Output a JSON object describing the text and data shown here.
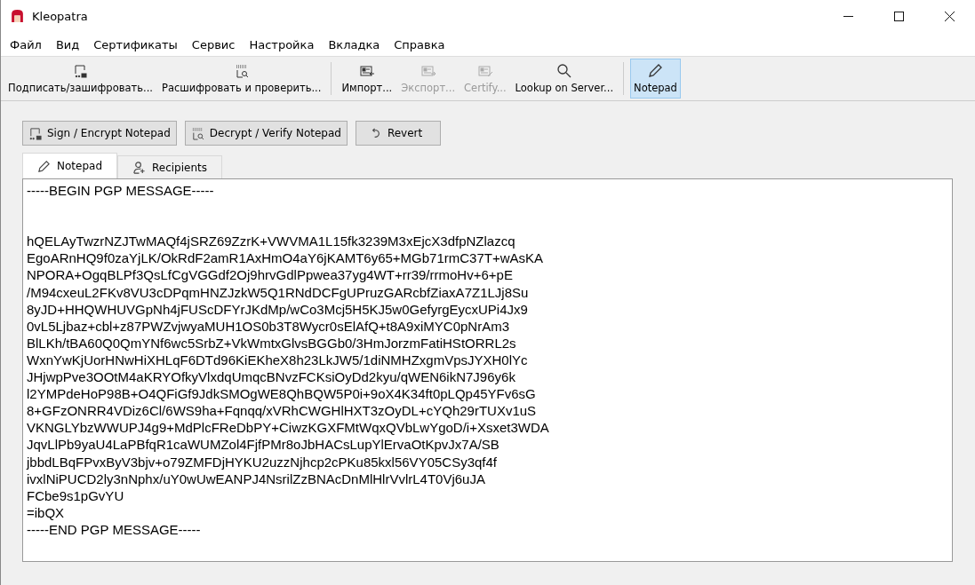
{
  "window": {
    "title": "Kleopatra"
  },
  "menu": [
    "Файл",
    "Вид",
    "Сертификаты",
    "Сервис",
    "Настройка",
    "Вкладка",
    "Справка"
  ],
  "toolbar": [
    {
      "kind": "sign",
      "label": "Подписать/зашифровать...",
      "enabled": true,
      "selected": false
    },
    {
      "kind": "decrypt",
      "label": "Расшифровать и проверить...",
      "enabled": true,
      "selected": false
    },
    {
      "kind": "import",
      "label": "Импорт...",
      "enabled": true,
      "selected": false
    },
    {
      "kind": "export",
      "label": "Экспорт...",
      "enabled": false,
      "selected": false
    },
    {
      "kind": "certify",
      "label": "Certify...",
      "enabled": false,
      "selected": false
    },
    {
      "kind": "lookup",
      "label": "Lookup on Server...",
      "enabled": true,
      "selected": false
    },
    {
      "kind": "notepad",
      "label": "Notepad",
      "enabled": true,
      "selected": true
    }
  ],
  "actions": [
    {
      "kind": "sign",
      "label": "Sign / Encrypt Notepad"
    },
    {
      "kind": "decrypt",
      "label": "Decrypt / Verify Notepad"
    },
    {
      "kind": "revert",
      "label": "Revert"
    }
  ],
  "tabs": [
    {
      "kind": "notepad",
      "label": "Notepad",
      "selected": true
    },
    {
      "kind": "recipients",
      "label": "Recipients",
      "selected": false
    }
  ],
  "notepad": {
    "value": "-----BEGIN PGP MESSAGE-----\n\n\nhQELAyTwzrNZJTwMAQf4jSRZ69ZzrK+VWVMA1L15fk3239M3xEjcX3dfpNZlazcq\nEgoARnHQ9f0zaYjLK/OkRdF2amR1AxHmO4aY6jKAMT6y65+MGb71rmC37T+wAsKA\nNPORA+OgqBLPf3QsLfCgVGGdf2Oj9hrvGdlPpwea37yg4WT+rr39/rrmoHv+6+pE\n/M94cxeuL2FKv8VU3cDPqmHNZJzkW5Q1RNdDCFgUPruzGARcbfZiaxA7Z1LJj8Su\n8yJD+HHQWHUVGpNh4jFUScDFYrJKdMp/wCo3Mcj5H5KJ5w0GefyrgEycxUPi4Jx9\n0vL5Ljbaz+cbl+z87PWZvjwyaMUH1OS0b3T8Wycr0sElAfQ+t8A9xiMYC0pNrAm3\nBlLKh/tBA60Q0QmYNf6wc5SrbZ+VkWmtxGlvsBGGb0/3HmJorzmFatiHStORRL2s\nWxnYwKjUorHNwHiXHLqF6DTd96KiEKheX8h23LkJW5/1diNMHZxgmVpsJYXH0lYc\nJHjwpPve3OOtM4aKRYOfkyVlxdqUmqcBNvzFCKsiOyDd2kyu/qWEN6ikN7J96y6k\nl2YMPdeHoP98B+O4QFiGf9JdkSMOgWE8QhBQW5P0i+9oX4K34ft0pLQp45YFv6sG\n8+GFzONRR4VDiz6Cl/6WS9ha+Fqnqq/xVRhCWGHlHXT3zOyDL+cYQh29rTUXv1uS\nVKNGLYbzWWUPJ4g9+MdPlcFReDbPY+CiwzKGXFMtWqxQVbLwYgoD/i+Xsxet3WDA\nJqvLlPb9yaU4LaPBfqR1caWUMZol4FjfPMr8oJbHACsLupYlErvaOtKpvJx7A/SB\njbbdLBqFPvxByV3bjv+o79ZMFDjHYKU2uzzNjhcp2cPKu85kxl56VY05CSy3qf4f\nivxlNiPUCD2ly3nNphx/uY0wUwEANPJ4NsrilZzBNAcDnMlHlrVvlrL4T0Vj6uJA\nFCbe9s1pGvYU\n=ibQX\n-----END PGP MESSAGE-----"
  }
}
